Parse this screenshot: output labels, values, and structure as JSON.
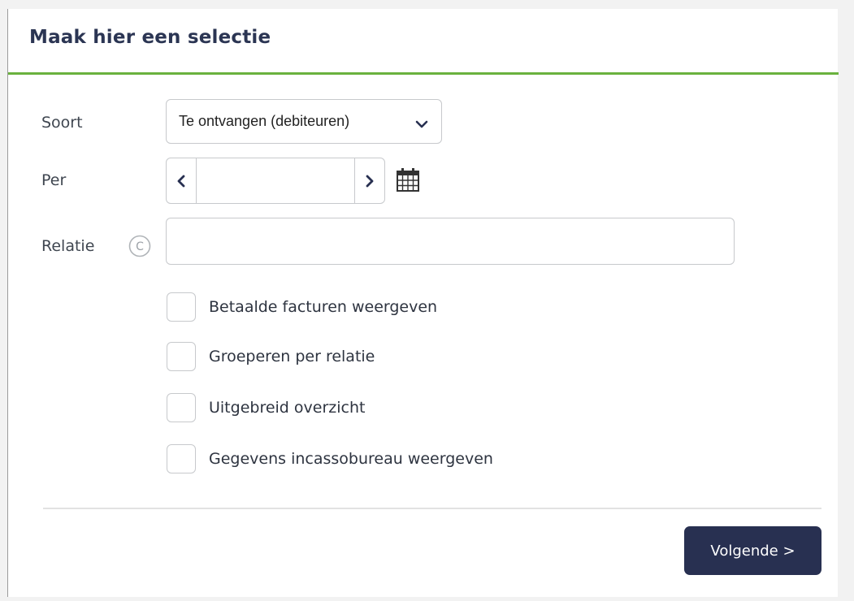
{
  "panel": {
    "title": "Maak hier een selectie"
  },
  "form": {
    "soort": {
      "label": "Soort",
      "selected": "Te ontvangen (debiteuren)"
    },
    "per": {
      "label": "Per",
      "value": "",
      "prev_icon": "chevron-left-icon",
      "next_icon": "chevron-right-icon",
      "calendar_icon": "calendar-icon"
    },
    "relatie": {
      "label": "Relatie",
      "info_icon_glyph": "C",
      "value": ""
    },
    "checkboxes": [
      {
        "label": "Betaalde facturen weergeven",
        "checked": false
      },
      {
        "label": "Groeperen per relatie",
        "checked": false
      },
      {
        "label": "Uitgebreid overzicht",
        "checked": false
      },
      {
        "label": "Gegevens incassobureau weergeven",
        "checked": false
      }
    ]
  },
  "footer": {
    "next_label": "Volgende >"
  },
  "colors": {
    "accent_green": "#6ab23e",
    "title_navy": "#2b3553",
    "button_bg": "#283051",
    "border_gray": "#c7c9cc"
  }
}
